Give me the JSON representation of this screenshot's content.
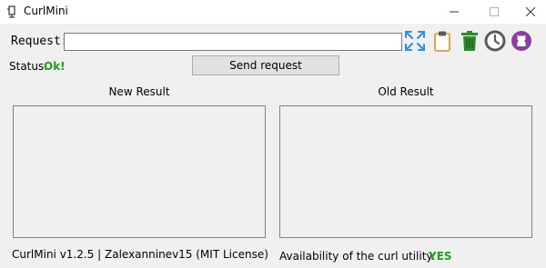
{
  "window": {
    "title": "CurlMini",
    "icons": {
      "app": "app-icon",
      "minimize": "minimize-icon",
      "maximize": "maximize-icon",
      "close": "close-icon"
    }
  },
  "request": {
    "label": "Request:",
    "value": "",
    "placeholder": ""
  },
  "toolbar": {
    "expand_icon": "expand-icon",
    "clipboard_icon": "clipboard-icon",
    "trash_icon": "trash-icon",
    "history_icon": "history-icon",
    "github_icon": "github-icon"
  },
  "status": {
    "label": "Status:",
    "value": "Ok!"
  },
  "send_button": {
    "label": "Send request"
  },
  "results": {
    "new_label": "New Result",
    "old_label": "Old Result",
    "new_content": "",
    "old_content": ""
  },
  "footer": {
    "left": "CurlMini v1.2.5 |  Zalexanninev15 (MIT License)",
    "availability_label": "Availability of the curl utility:",
    "availability_value": "YES"
  },
  "colors": {
    "status_green": "#1aa01a",
    "expand_blue": "#2b8fe3",
    "clipboard_orange": "#e8a24a",
    "trash_green": "#2f8a2f",
    "history_gray": "#5a5a5a",
    "github_purple": "#8a3fa0"
  }
}
